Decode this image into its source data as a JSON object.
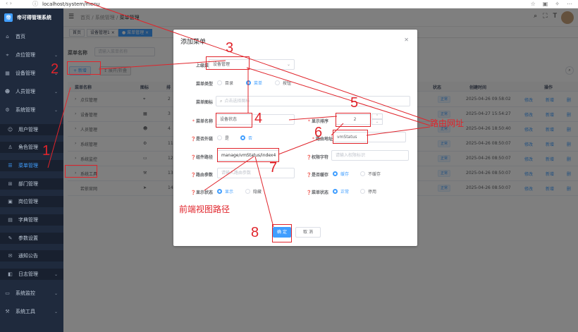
{
  "browser": {
    "url": "localhost/system/menu",
    "nav_icon": "back-forward-icon",
    "icons": [
      "star-icon",
      "collection-icon",
      "extension-icon",
      "more-icon"
    ]
  },
  "sidebar": {
    "logo_text": "帝可得管理系统",
    "logo_icon": "帝",
    "items": [
      {
        "label": "首页",
        "icon": "home-icon"
      },
      {
        "label": "点位管理",
        "icon": "location-icon",
        "expandable": true
      },
      {
        "label": "设备管理",
        "icon": "device-icon",
        "expandable": true
      },
      {
        "label": "人员管理",
        "icon": "people-icon",
        "expandable": true
      },
      {
        "label": "系统管理",
        "icon": "gear-icon",
        "expandable": true
      },
      {
        "label": "用户管理",
        "icon": "user-icon",
        "sub": true
      },
      {
        "label": "角色管理",
        "icon": "role-icon",
        "sub": true
      },
      {
        "label": "菜单管理",
        "icon": "menu-icon",
        "sub": true,
        "active": true
      },
      {
        "label": "部门管理",
        "icon": "dept-icon",
        "sub": true
      },
      {
        "label": "岗位管理",
        "icon": "post-icon",
        "sub": true
      },
      {
        "label": "字典管理",
        "icon": "dict-icon",
        "sub": true
      },
      {
        "label": "参数设置",
        "icon": "param-icon",
        "sub": true
      },
      {
        "label": "通知公告",
        "icon": "notice-icon",
        "sub": true
      },
      {
        "label": "日志管理",
        "icon": "log-icon",
        "sub": true,
        "expandable": true
      },
      {
        "label": "系统监控",
        "icon": "monitor-icon",
        "expandable": true
      },
      {
        "label": "系统工具",
        "icon": "tool-icon",
        "expandable": true
      }
    ]
  },
  "header": {
    "breadcrumb": [
      "首页",
      "系统管理",
      "菜单管理"
    ],
    "icons": [
      "search-icon",
      "fullscreen-icon",
      "font-size-icon"
    ]
  },
  "tags": [
    {
      "label": "首页",
      "active": false
    },
    {
      "label": "设备管理1 ×",
      "active": false
    },
    {
      "label": "● 菜单管理 ×",
      "active": true
    }
  ],
  "search": {
    "label": "菜单名称",
    "placeholder": "请输入菜单名称"
  },
  "toolbar": {
    "add_label": "+ 新增",
    "expand_label": "↕ 展开/折叠"
  },
  "table": {
    "columns": [
      "菜单名称",
      "图标",
      "排",
      "状态",
      "创建时间",
      "操作"
    ],
    "rows": [
      {
        "name": "点位管理",
        "icon": "location-icon",
        "order": "2",
        "status": "正常",
        "time": "2025-04-26 09:58:02",
        "expandable": true
      },
      {
        "name": "设备管理",
        "icon": "device-icon",
        "order": "3",
        "status": "正常",
        "time": "2025-04-27 15:54:27",
        "expandable": true
      },
      {
        "name": "人员管理",
        "icon": "people-icon",
        "order": "4",
        "status": "正常",
        "time": "2025-04-26 18:50:40",
        "expandable": true
      },
      {
        "name": "系统管理",
        "icon": "gear-icon",
        "order": "11",
        "status": "正常",
        "time": "2025-04-26 08:50:07",
        "expandable": true
      },
      {
        "name": "系统监控",
        "icon": "monitor-icon",
        "order": "12",
        "status": "正常",
        "time": "2025-04-26 08:50:07",
        "expandable": true
      },
      {
        "name": "系统工具",
        "icon": "tool-icon",
        "order": "13",
        "status": "正常",
        "time": "2025-04-26 08:50:07",
        "expandable": true
      },
      {
        "name": "若依官网",
        "icon": "send-icon",
        "order": "14",
        "status": "正常",
        "time": "2025-04-26 08:50:07",
        "expandable": false
      }
    ],
    "ops": {
      "edit": "修改",
      "add": "新增",
      "delete": "删"
    }
  },
  "dialog": {
    "title": "添加菜单",
    "fields": {
      "parent": {
        "label": "上级菜单",
        "value": "设备管理"
      },
      "menu_type": {
        "label": "菜单类型",
        "options": [
          "目录",
          "菜单",
          "按钮"
        ],
        "selected": "菜单"
      },
      "menu_icon": {
        "label": "菜单图标",
        "placeholder": "点击选择图标"
      },
      "menu_name": {
        "label": "菜单名称",
        "value": "设备状态"
      },
      "sort": {
        "label": "显示排序",
        "value": "2"
      },
      "is_frame": {
        "label": "是否外链",
        "options": [
          "是",
          "否"
        ],
        "selected": "否"
      },
      "route_path": {
        "label": "路由地址",
        "value": "vmStatus"
      },
      "component": {
        "label": "组件路径",
        "value": "manage/vmStatus/index4"
      },
      "perms": {
        "label": "权限字符",
        "placeholder": "请输入权限标识"
      },
      "query": {
        "label": "路由参数",
        "placeholder": "请输入路由参数"
      },
      "is_cache": {
        "label": "是否缓存",
        "options": [
          "缓存",
          "不缓存"
        ],
        "selected": "缓存"
      },
      "visible": {
        "label": "显示状态",
        "options": [
          "显示",
          "隐藏"
        ],
        "selected": "显示"
      },
      "status": {
        "label": "菜单状态",
        "options": [
          "正常",
          "停用"
        ],
        "selected": "正常"
      }
    },
    "ok_label": "确 定",
    "cancel_label": "取 消"
  },
  "annotations": {
    "numbers": [
      "1",
      "2",
      "3",
      "4",
      "5",
      "6",
      "7",
      "8"
    ],
    "route_text": "路由网址",
    "view_path_text": "前端视图路径",
    "color": "#e0242b"
  },
  "colors": {
    "primary": "#409eff",
    "sidebar_bg": "#1f2a3d",
    "annotation": "#e0242b"
  }
}
